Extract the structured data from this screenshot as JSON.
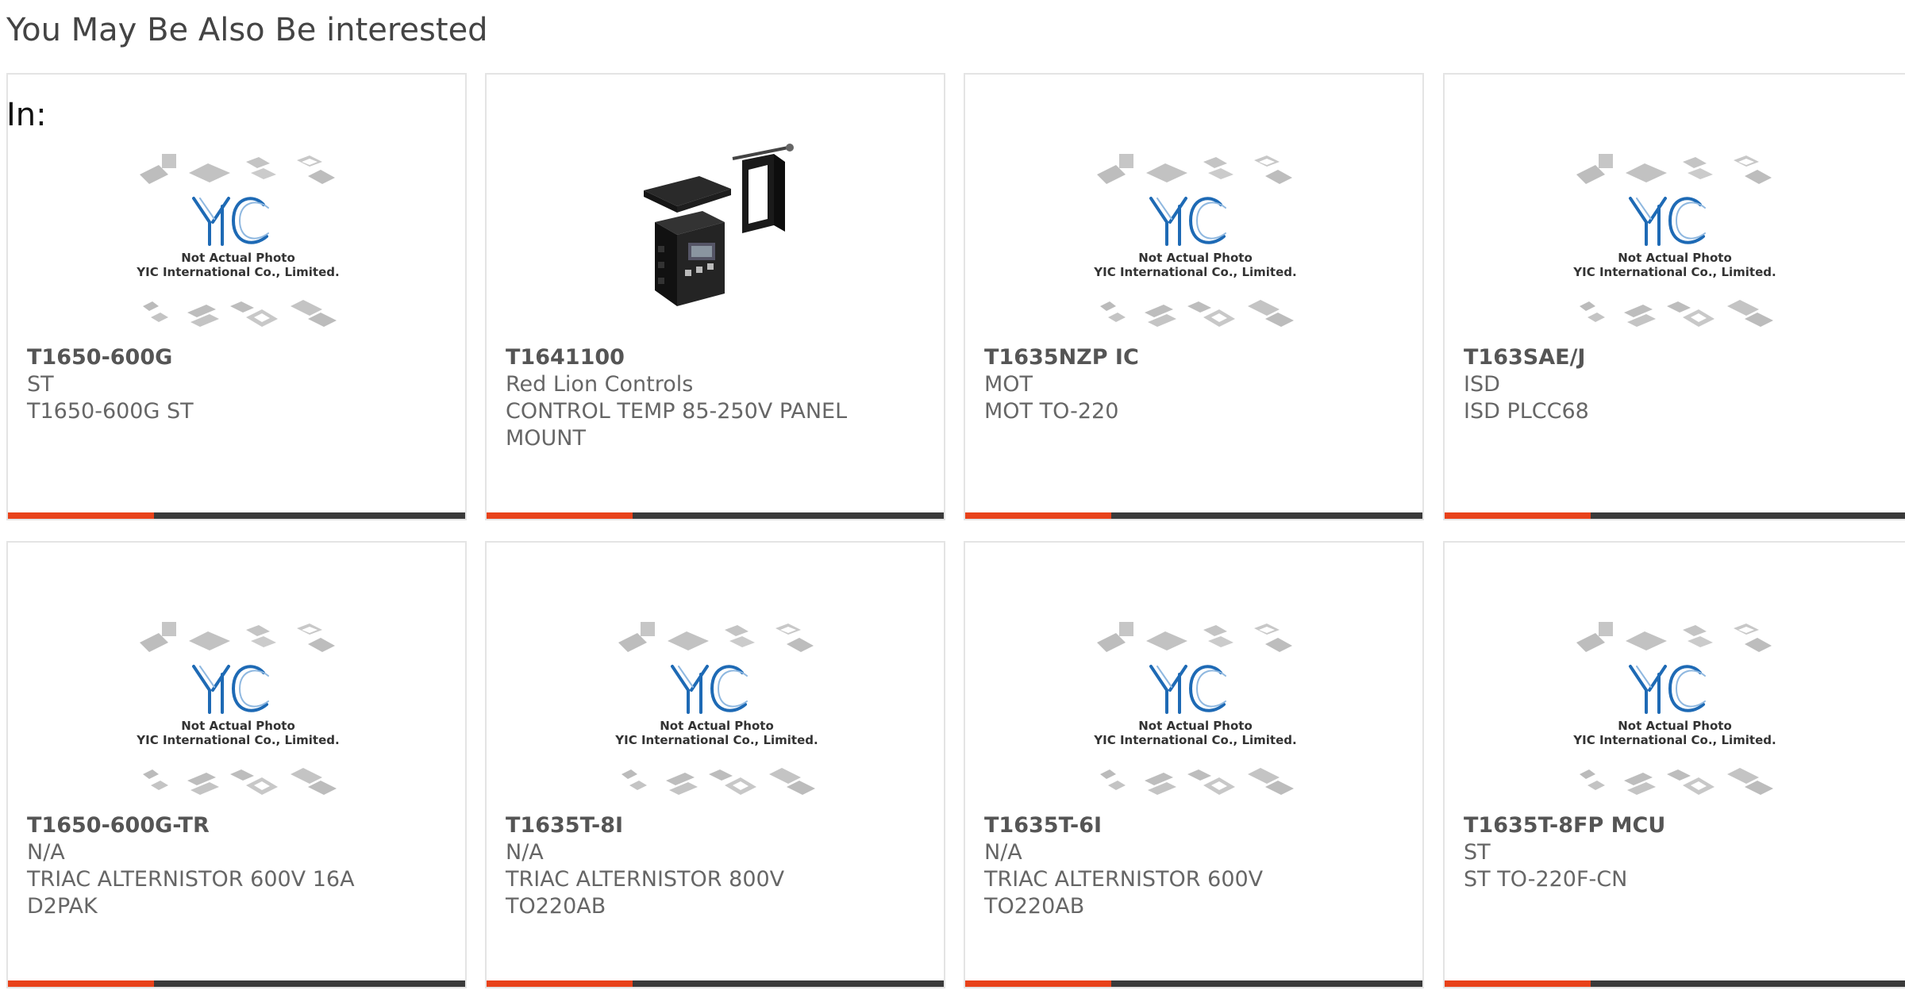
{
  "section": {
    "title": "You May Be Also Be interested",
    "lead": "In:"
  },
  "colors": {
    "accent": "#e8421a",
    "bar": "#3a3a3a",
    "logo_blue": "#1e6ab5",
    "text": "#666666"
  },
  "placeholder": {
    "line1": "Not Actual Photo",
    "line2": "YIC International Co., Limited."
  },
  "products": [
    {
      "part": "T1650-600G",
      "maker": "ST",
      "desc": "T1650-600G ST",
      "desc2": "",
      "image": "placeholder"
    },
    {
      "part": "T1641100",
      "maker": "Red Lion Controls",
      "desc": "CONTROL TEMP 85-250V PANEL",
      "desc2": "MOUNT",
      "image": "controller-photo"
    },
    {
      "part": "T1635NZP IC",
      "maker": "MOT",
      "desc": "MOT TO-220",
      "desc2": "",
      "image": "placeholder"
    },
    {
      "part": "T163SAE/J",
      "maker": "ISD",
      "desc": "ISD PLCC68",
      "desc2": "",
      "image": "placeholder"
    },
    {
      "part": "T1650-600G-TR",
      "maker": "N/A",
      "desc": "TRIAC ALTERNISTOR 600V 16A",
      "desc2": "D2PAK",
      "image": "placeholder"
    },
    {
      "part": "T1635T-8I",
      "maker": "N/A",
      "desc": "TRIAC ALTERNISTOR 800V",
      "desc2": "TO220AB",
      "image": "placeholder"
    },
    {
      "part": "T1635T-6I",
      "maker": "N/A",
      "desc": "TRIAC ALTERNISTOR 600V",
      "desc2": "TO220AB",
      "image": "placeholder"
    },
    {
      "part": "T1635T-8FP MCU",
      "maker": "ST",
      "desc": "ST TO-220F-CN",
      "desc2": "",
      "image": "placeholder"
    }
  ]
}
